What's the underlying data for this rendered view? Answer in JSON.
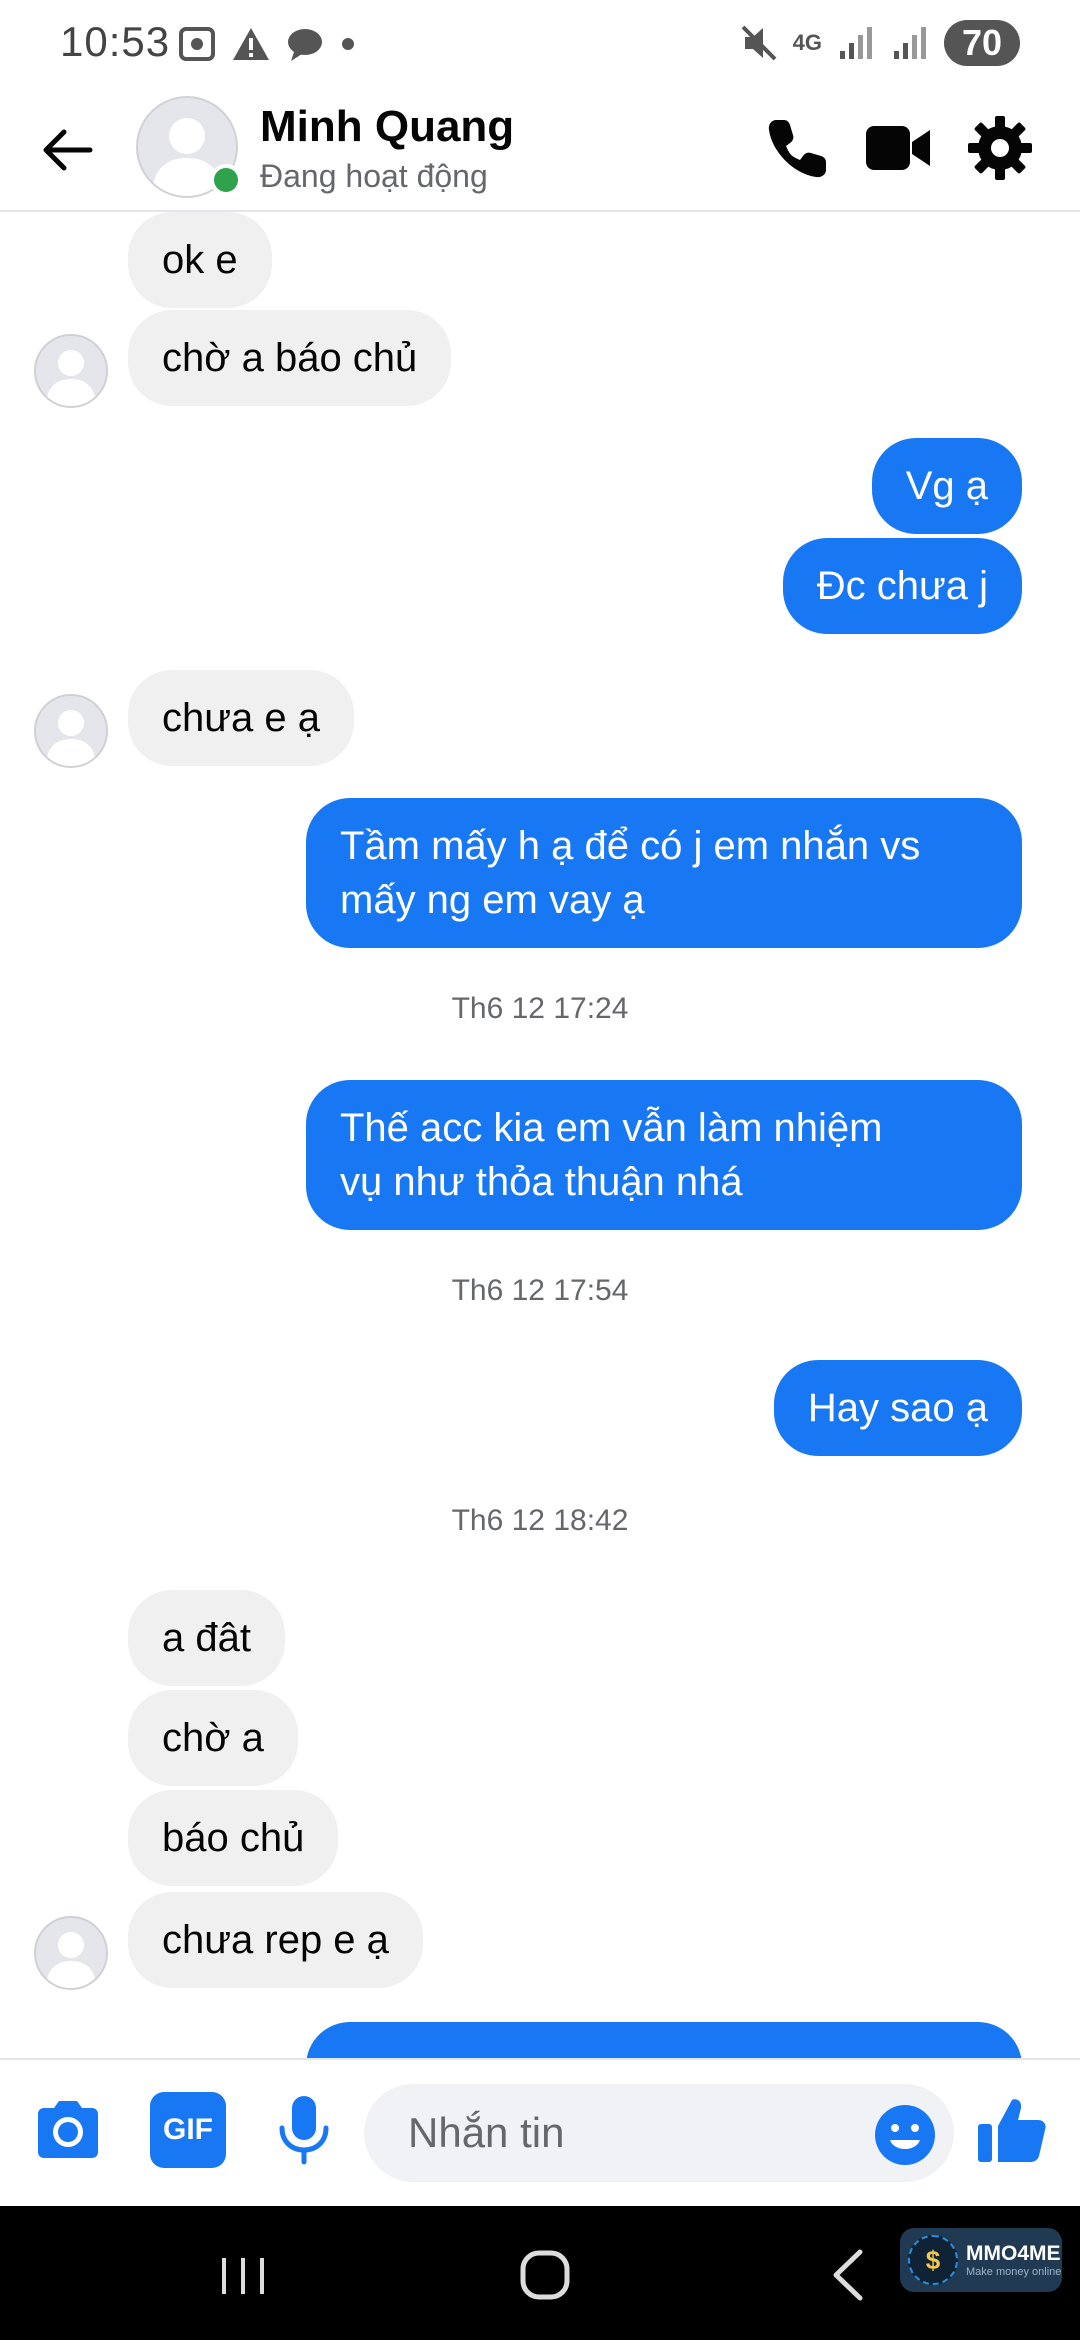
{
  "status_bar": {
    "time": "10:53",
    "network": "4G",
    "battery": "70"
  },
  "header": {
    "name": "Minh Quang",
    "status": "Đang hoạt động"
  },
  "messages": {
    "m1": "ok e",
    "m2": "chờ a báo chủ",
    "m3": "Vg ạ",
    "m4": "Đc chưa j",
    "m5": "chưa e ạ",
    "m6": "Tầm mấy h ạ để có j em nhắn vs\nmấy ng em vay ạ",
    "ts1": "Th6 12 17:24",
    "m7": "Thế acc kia em vẫn làm nhiệm\nvụ như thỏa thuận nhá",
    "ts2": "Th6 12 17:54",
    "m8": "Hay sao ạ",
    "ts3": "Th6 12 18:42",
    "m9": "a đât",
    "m10": "chờ a",
    "m11": "báo chủ",
    "m12": "chưa rep e ạ"
  },
  "composer": {
    "placeholder": "Nhắn tin",
    "gif_label": "GIF"
  },
  "watermark": {
    "title": "MMO4ME",
    "subtitle": "Make money online"
  },
  "colors": {
    "accent": "#1877f2",
    "incoming_bubble": "#f0f0f0",
    "online": "#31a24c"
  },
  "icons": [
    "back-arrow-icon",
    "phone-icon",
    "video-icon",
    "gear-icon",
    "camera-icon",
    "gif-icon",
    "microphone-icon",
    "emoji-icon",
    "like-icon",
    "recents-icon",
    "home-icon",
    "nav-back-icon"
  ]
}
